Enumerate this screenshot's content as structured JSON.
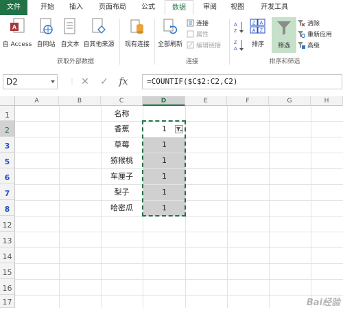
{
  "ribbon_tabs": [
    {
      "label": "文件"
    },
    {
      "label": "开始"
    },
    {
      "label": "插入"
    },
    {
      "label": "页面布局"
    },
    {
      "label": "公式"
    },
    {
      "label": "数据"
    },
    {
      "label": "审阅"
    },
    {
      "label": "视图"
    },
    {
      "label": "开发工具"
    }
  ],
  "active_tab": "数据",
  "ribbon": {
    "get_external": {
      "from_access": "自 Access",
      "from_web": "自网站",
      "from_text": "自文本",
      "from_other": "自其他来源",
      "existing": "现有连接",
      "group_label": "获取外部数据"
    },
    "connections": {
      "refresh_all": "全部刷新",
      "connections": "连接",
      "properties": "属性",
      "edit_links": "编辑链接",
      "group_label": "连接"
    },
    "sort_filter": {
      "sort": "排序",
      "filter": "筛选",
      "clear": "清除",
      "reapply": "重新应用",
      "advanced": "高级",
      "group_label": "排序和筛选"
    }
  },
  "formula_bar": {
    "name_box": "D2",
    "cancel_symbol": "✕",
    "enter_symbol": "✓",
    "fx_symbol": "fx",
    "formula": "=COUNTIF($C$2:C2,C2)"
  },
  "sheet": {
    "columns": [
      "A",
      "B",
      "C",
      "D",
      "E",
      "F",
      "G",
      "H"
    ],
    "rows": [
      "1",
      "2",
      "3",
      "5",
      "6",
      "7",
      "8",
      "12",
      "13",
      "14",
      "15",
      "16",
      "17"
    ],
    "column_c": [
      "名称",
      "香蕉",
      "草莓",
      "猕猴桃",
      "车厘子",
      "梨子",
      "哈密瓜"
    ],
    "column_d": [
      "D",
      "1",
      "1",
      "1",
      "1",
      "1",
      "1"
    ],
    "active_column": "D"
  },
  "watermark": "Bai经验"
}
